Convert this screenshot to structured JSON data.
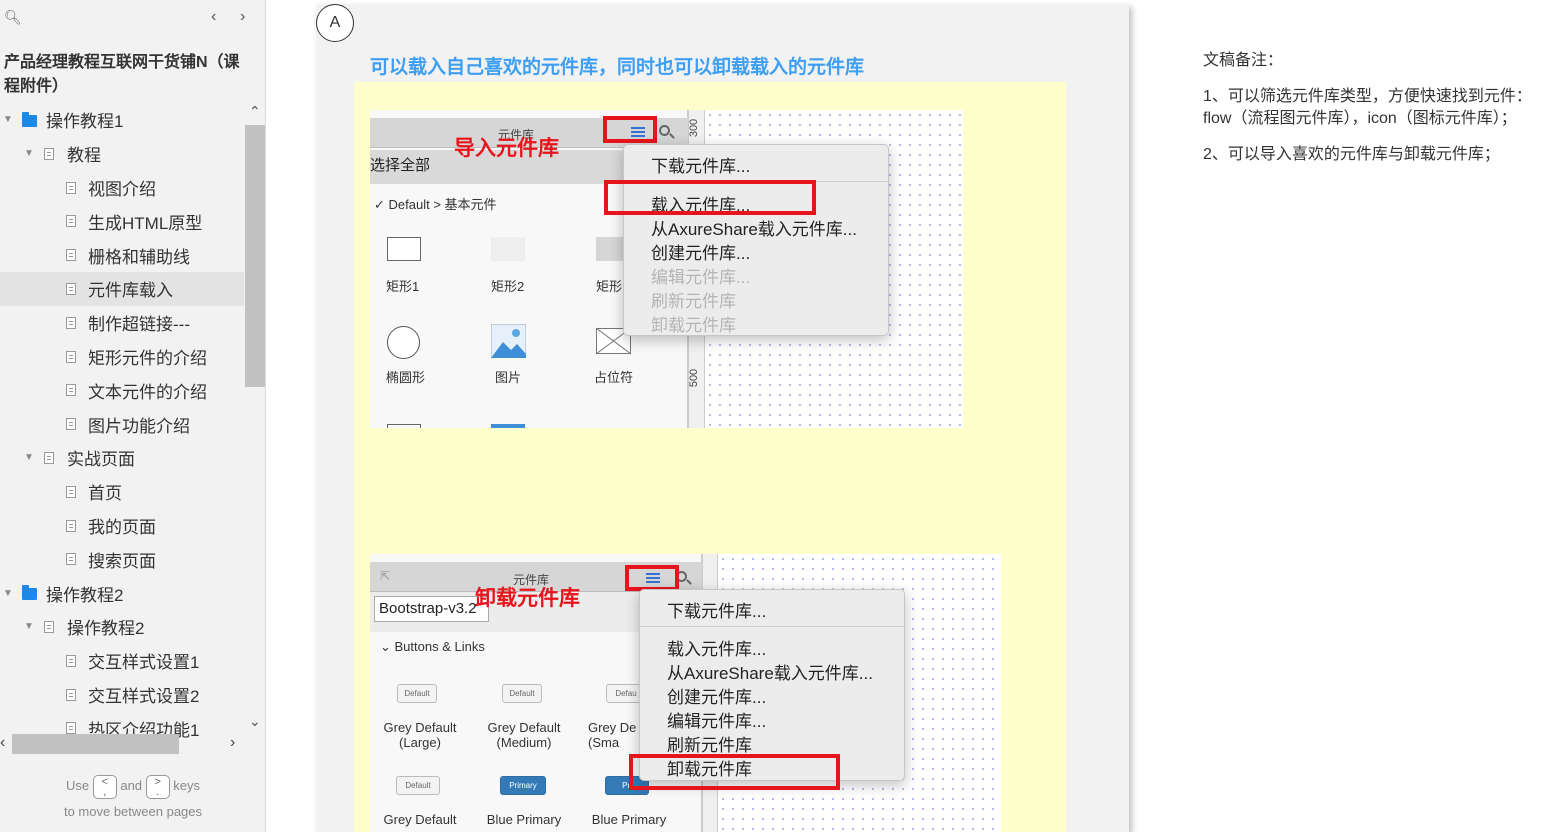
{
  "sidebar": {
    "project_title": "产品经理教程互联网干货铺N（课程附件）",
    "tree": [
      {
        "label": "操作教程1",
        "type": "folder",
        "level": 0
      },
      {
        "label": "教程",
        "type": "page-group",
        "level": 1
      },
      {
        "label": "视图介绍",
        "type": "page",
        "level": 2
      },
      {
        "label": "生成HTML原型",
        "type": "page",
        "level": 2
      },
      {
        "label": "栅格和辅助线",
        "type": "page",
        "level": 2
      },
      {
        "label": "元件库载入",
        "type": "page",
        "level": 2,
        "selected": true
      },
      {
        "label": "制作超链接---",
        "type": "page",
        "level": 2
      },
      {
        "label": "矩形元件的介绍",
        "type": "page",
        "level": 2
      },
      {
        "label": "文本元件的介绍",
        "type": "page",
        "level": 2
      },
      {
        "label": "图片功能介绍",
        "type": "page",
        "level": 2
      },
      {
        "label": "实战页面",
        "type": "page-group",
        "level": 1
      },
      {
        "label": "首页",
        "type": "page",
        "level": 2
      },
      {
        "label": "我的页面",
        "type": "page",
        "level": 2
      },
      {
        "label": "搜索页面",
        "type": "page",
        "level": 2
      },
      {
        "label": "操作教程2",
        "type": "folder",
        "level": 0
      },
      {
        "label": "操作教程2",
        "type": "page-group",
        "level": 1
      },
      {
        "label": "交互样式设置1",
        "type": "page",
        "level": 2
      },
      {
        "label": "交互样式设置2",
        "type": "page",
        "level": 2
      },
      {
        "label": "热区介绍功能1",
        "type": "page",
        "level": 2
      }
    ],
    "hint_use": "Use",
    "hint_and": "and",
    "hint_keys": "keys",
    "hint_line2": "to move between pages",
    "key_prev": "<\n,",
    "key_next": ">\n."
  },
  "canvas": {
    "badge": "A",
    "heading": "可以载入自己喜欢的元件库，同时也可以卸载载入的元件库",
    "shot1": {
      "panel_title": "元件库",
      "select_all": "选择全部",
      "group": "Default > 基本元件",
      "callout": "导入元件库",
      "ruler_300": "300",
      "ruler_500": "500",
      "widgets": [
        "矩形1",
        "矩形2",
        "矩形",
        "椭圆形",
        "图片",
        "占位符"
      ],
      "menu": [
        {
          "label": "下载元件库...",
          "disabled": false
        },
        {
          "label": "载入元件库...",
          "disabled": false
        },
        {
          "label": "从AxureShare载入元件库...",
          "disabled": false
        },
        {
          "label": "创建元件库...",
          "disabled": false
        },
        {
          "label": "编辑元件库...",
          "disabled": true
        },
        {
          "label": "刷新元件库",
          "disabled": true
        },
        {
          "label": "卸载元件库",
          "disabled": true
        }
      ]
    },
    "shot2": {
      "panel_title": "元件库",
      "select_value": "Bootstrap-v3.2",
      "group": "Buttons & Links",
      "callout": "卸载元件库",
      "btn_default": "Default",
      "btn_primary": "Primary",
      "btn_primary_short": "Pri",
      "btn_default_short": "Defau",
      "captions": [
        "Grey Default\n(Large)",
        "Grey Default\n(Medium)",
        "Grey De\n(Sma",
        "Grey Default",
        "Blue Primary",
        "Blue Primary"
      ],
      "menu": [
        {
          "label": "下载元件库..."
        },
        {
          "label": "载入元件库..."
        },
        {
          "label": "从AxureShare载入元件库..."
        },
        {
          "label": "创建元件库..."
        },
        {
          "label": "编辑元件库..."
        },
        {
          "label": "刷新元件库"
        },
        {
          "label": "卸载元件库"
        }
      ]
    }
  },
  "notes": {
    "title": "文稿备注：",
    "p1_line1": "1、可以筛选元件库类型，方便快速找到元件：",
    "p1_line2": "flow（流程图元件库），icon（图标元件库）；",
    "p2": "2、可以导入喜欢的元件库与卸载元件库；"
  },
  "colors": {
    "heading": "#3d9ef3",
    "callout_red": "#e8141c",
    "folder_blue": "#1e88e5",
    "note_yellow": "#ffffcc"
  }
}
